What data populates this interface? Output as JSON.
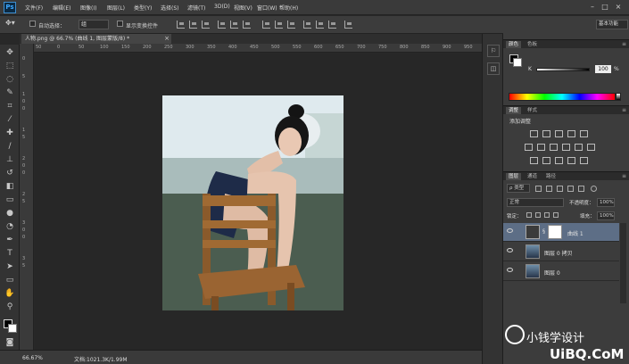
{
  "app": {
    "logo": "Ps"
  },
  "menu": [
    "文件(F)",
    "编辑(E)",
    "图像(I)",
    "图层(L)",
    "类型(Y)",
    "选择(S)",
    "滤镜(T)",
    "3D(D)",
    "视图(V)",
    "窗口(W)",
    "帮助(H)"
  ],
  "window_buttons": [
    "–",
    "□",
    "×"
  ],
  "options": {
    "auto_select_label": "自动选择：",
    "auto_select_value": "组",
    "show_transform_label": "显示变换控件",
    "workspace": "基本功能"
  },
  "document": {
    "tab_title": "人物.png @ 66.7% (曲线 1, 图层蒙版/8) *",
    "tab_close": "×",
    "zoom": "66.67%",
    "info": "文档:1021.3K/1.99M"
  },
  "ruler_h": [
    "50",
    "0",
    "50",
    "100",
    "150",
    "200",
    "250",
    "300",
    "350",
    "400",
    "450",
    "500",
    "550",
    "600",
    "650",
    "700",
    "750",
    "800",
    "850",
    "900",
    "950"
  ],
  "ruler_v": [
    "0",
    "5",
    "1",
    "0",
    "0",
    "1",
    "5",
    "2",
    "0",
    "0",
    "2",
    "5",
    "3",
    "0",
    "0",
    "3",
    "5"
  ],
  "color_panel": {
    "tabs": [
      "颜色",
      "色板"
    ],
    "channel": "K",
    "value": "100",
    "unit": "%"
  },
  "adjustments_panel": {
    "tabs": [
      "调整",
      "样式"
    ],
    "title": "添加调整"
  },
  "layers_panel": {
    "tabs": [
      "图层",
      "通道",
      "路径"
    ],
    "kind": "ρ 类型",
    "blend_mode": "正常",
    "opacity_label": "不透明度：",
    "opacity": "100%",
    "lock_label": "锁定：",
    "fill_label": "填充：",
    "fill": "100%",
    "layers": [
      {
        "name": "曲线 1",
        "selected": true
      },
      {
        "name": "图层 0 拷贝",
        "selected": false
      },
      {
        "name": "图层 0",
        "selected": false
      }
    ]
  },
  "watermark": {
    "line1": "小钱学设计",
    "line2": "UiBQ.CoM"
  },
  "colors": {
    "selected_layer": "#5d6e86",
    "accent": "#3ea7ff"
  }
}
